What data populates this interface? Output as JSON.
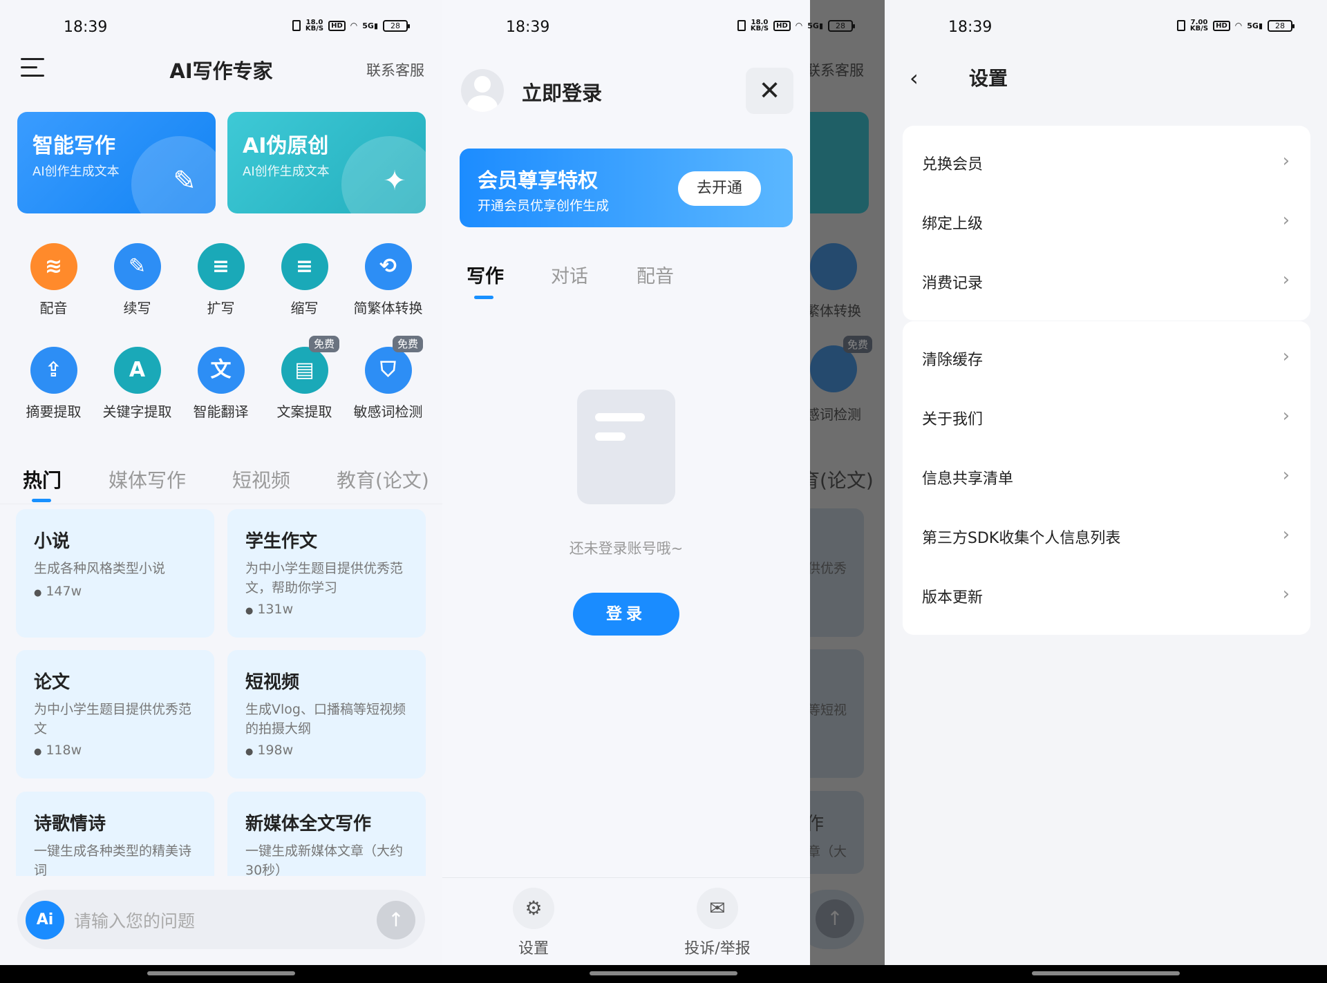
{
  "status": {
    "time": "18:39",
    "speed1": "18.0",
    "speed2": "18.0",
    "speed3": "7.00",
    "speed_unit": "KB/S",
    "hd": "HD",
    "net": "5G",
    "battery": "28"
  },
  "home": {
    "menu_icon": "hamburger-icon",
    "title": "AI写作专家",
    "support": "联系客服",
    "cards": [
      {
        "title": "智能写作",
        "subtitle": "AI创作生成文本",
        "icon": "pencil-icon"
      },
      {
        "title": "AI伪原创",
        "subtitle": "AI创作生成文本",
        "icon": "magic-wand-icon"
      }
    ],
    "tools": [
      {
        "label": "配音",
        "icon": "waveform-icon",
        "color": "#ff8a2b",
        "badge": ""
      },
      {
        "label": "续写",
        "icon": "edit-icon",
        "color": "#2d8ef5",
        "badge": ""
      },
      {
        "label": "扩写",
        "icon": "expand-text-icon",
        "color": "#1aa9b8",
        "badge": ""
      },
      {
        "label": "缩写",
        "icon": "shrink-text-icon",
        "color": "#1aa9b8",
        "badge": ""
      },
      {
        "label": "简繁体转换",
        "icon": "convert-icon",
        "color": "#2d8ef5",
        "badge": ""
      },
      {
        "label": "摘要提取",
        "icon": "extract-icon",
        "color": "#2d8ef5",
        "badge": ""
      },
      {
        "label": "关键字提取",
        "icon": "letter-a-icon",
        "color": "#1aa9b8",
        "badge": ""
      },
      {
        "label": "智能翻译",
        "icon": "translate-icon",
        "color": "#2d8ef5",
        "badge": ""
      },
      {
        "label": "文案提取",
        "icon": "document-icon",
        "color": "#1aa9b8",
        "badge": "免费"
      },
      {
        "label": "敏感词检测",
        "icon": "shield-search-icon",
        "color": "#2d8ef5",
        "badge": "免费"
      }
    ],
    "tabs": [
      "热门",
      "媒体写作",
      "短视频",
      "教育(论文)"
    ],
    "templates": [
      {
        "title": "小说",
        "desc": "生成各种风格类型小说",
        "count": "147w"
      },
      {
        "title": "学生作文",
        "desc": "为中小学生题目提供优秀范文，帮助你学习",
        "count": "131w"
      },
      {
        "title": "论文",
        "desc": "为中小学生题目提供优秀范文",
        "count": "118w"
      },
      {
        "title": "短视频",
        "desc": "生成Vlog、口播稿等短视频的拍摄大纲",
        "count": "198w"
      },
      {
        "title": "诗歌情诗",
        "desc": "一键生成各种类型的精美诗词",
        "count": ""
      },
      {
        "title": "新媒体全文写作",
        "desc": "一键生成新媒体文章（大约30秒）",
        "count": ""
      }
    ],
    "input_placeholder": "请输入您的问题",
    "logo_text": "Ai"
  },
  "drawer": {
    "login_now": "立即登录",
    "close_glyph": "✕",
    "vip_title": "会员尊享特权",
    "vip_sub": "开通会员优享创作生成",
    "vip_button": "去开通",
    "tabs": [
      "写作",
      "对话",
      "配音"
    ],
    "empty_text": "还未登录账号哦~",
    "login_button": "登录",
    "footer": [
      {
        "label": "设置",
        "icon": "gear-icon"
      },
      {
        "label": "投诉/举报",
        "icon": "report-icon"
      }
    ],
    "behind": {
      "support": "联系客服",
      "tool": "繁体转换",
      "tool2": "感词检测",
      "badge": "免费",
      "tab": "育(论文)",
      "t1": "供优秀",
      "t2": "等短视",
      "t3": "作",
      "t4": "章（大"
    }
  },
  "settings": {
    "title": "设置",
    "group1": [
      "兑换会员",
      "绑定上级",
      "消费记录"
    ],
    "group2": [
      "清除缓存",
      "关于我们",
      "信息共享清单",
      "第三方SDK收集个人信息列表",
      "版本更新"
    ]
  }
}
